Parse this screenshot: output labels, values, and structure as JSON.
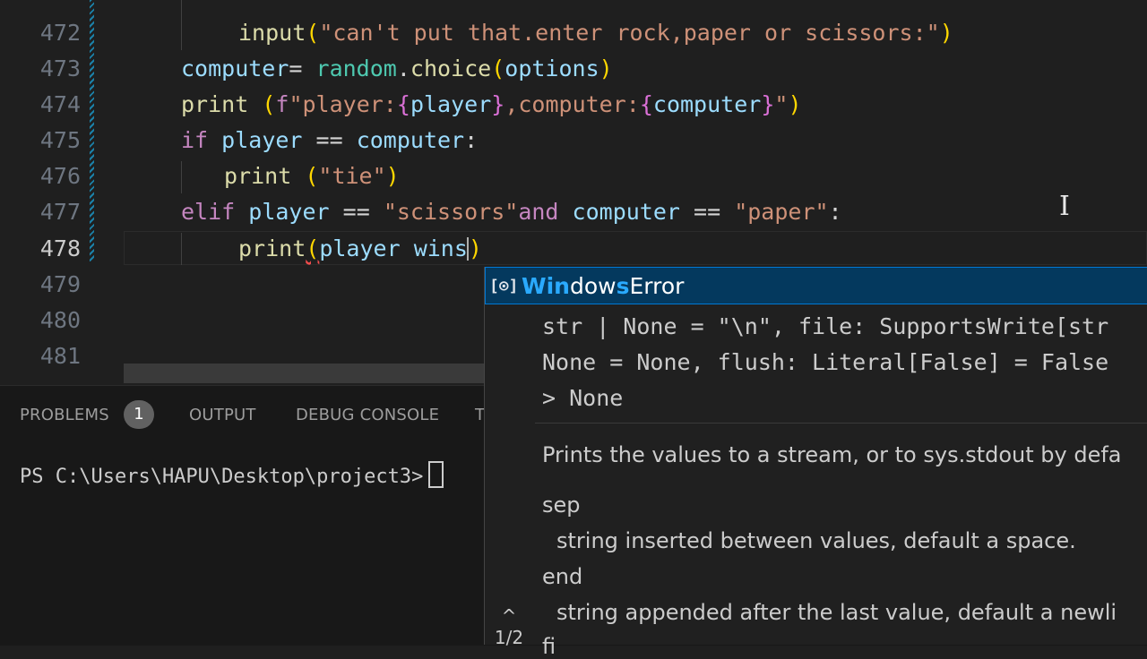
{
  "editor": {
    "lines": [
      {
        "num": "472",
        "active": false
      },
      {
        "num": "473",
        "active": false
      },
      {
        "num": "474",
        "active": false
      },
      {
        "num": "475",
        "active": false
      },
      {
        "num": "476",
        "active": false
      },
      {
        "num": "477",
        "active": false
      },
      {
        "num": "478",
        "active": true
      },
      {
        "num": "479",
        "active": false
      },
      {
        "num": "480",
        "active": false
      },
      {
        "num": "481",
        "active": false
      }
    ],
    "code": {
      "l472": {
        "fn": "input",
        "str": "\"can't put that.enter rock,paper or scissors:\""
      },
      "l473": {
        "var": "computer",
        "eq": "= ",
        "mod": "random",
        "dot": ".",
        "fn": "choice",
        "arg": "options"
      },
      "l474": {
        "fn": "print",
        "fprefix": "f",
        "s1": "\"player:",
        "v1": "player",
        "s2": ",computer:",
        "v2": "computer",
        "s3": "\""
      },
      "l475": {
        "kw": "if",
        "v1": "player",
        "op": " == ",
        "v2": "computer",
        "colon": ":"
      },
      "l476": {
        "fn": "print",
        "str": "\"tie\""
      },
      "l477": {
        "kw": "elif",
        "v1": "player",
        "op": " == ",
        "s1": "\"scissors\"",
        "kw2": "and",
        "v2": "computer",
        "op2": " == ",
        "s2": "\"paper\"",
        "colon": ":"
      },
      "l478": {
        "fn": "print",
        "paren": "(",
        "v1": "player",
        "v2": "wins",
        "close": ")"
      }
    }
  },
  "panel": {
    "tabs": [
      "PROBLEMS",
      "OUTPUT",
      "DEBUG CONSOLE",
      "T"
    ],
    "problems_count": "1",
    "terminal_prompt": "PS C:\\Users\\HAPU\\Desktop\\project3>"
  },
  "suggest": {
    "icon": "[⊙]",
    "label_parts": [
      "Win",
      "dow",
      "s",
      "Error"
    ],
    "signature": [
      "str | None = \"\\n\", file: SupportsWrite[str",
      "None = None, flush: Literal[False] = False",
      "> None"
    ],
    "doc": [
      "Prints the values to a stream, or to sys.stdout by defa",
      "sep",
      "string inserted between values, default a space.",
      "end",
      "string appended after the last value, default a newli",
      "fi"
    ],
    "nav_arrow": "^",
    "nav_count": "1/2"
  }
}
